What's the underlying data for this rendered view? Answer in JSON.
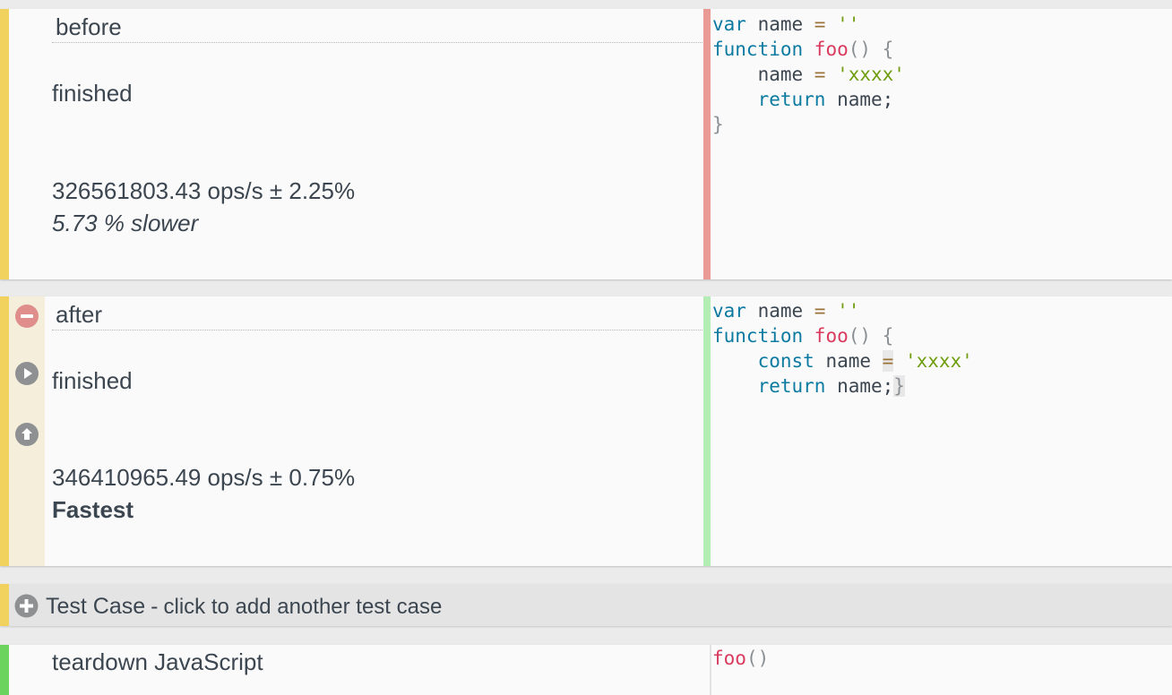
{
  "tests": [
    {
      "title": "before",
      "status": "finished",
      "ops": "326561803.43 ops/s ± 2.25%",
      "comparison": "5.73 % slower",
      "status_color": "#e99a94"
    },
    {
      "title": "after",
      "status": "finished",
      "ops": "346410965.49 ops/s ± 0.75%",
      "comparison": "Fastest",
      "status_color": "#b2edb4",
      "icons": [
        "remove-icon",
        "play-icon",
        "arrow-up-icon"
      ]
    }
  ],
  "code_before": {
    "l1_kw": "var",
    "l1_name": " name ",
    "l1_op": "=",
    "l1_str": " ''",
    "l2_kw": "function",
    "l2_fn": " foo",
    "l2_pn": "() {",
    "l3_name": "    name ",
    "l3_op": "=",
    "l3_str": " 'xxxx'",
    "l4_kw": "    return",
    "l4_rest": " name;",
    "l5_pn": "}"
  },
  "code_after": {
    "l1_kw": "var",
    "l1_name": " name ",
    "l1_op": "=",
    "l1_str": " ''",
    "l2_kw": "function",
    "l2_fn": " foo",
    "l2_pn": "() {",
    "l3_kw": "    const",
    "l3_name": " name ",
    "l3_op": "=",
    "l3_str": " 'xxxx'",
    "l4_kw": "    return",
    "l4_rest": " name;",
    "l4_pn": "}"
  },
  "add_test": {
    "label": "Test Case",
    "separator": "-",
    "hint": "click to add another test case"
  },
  "teardown": {
    "title": "teardown JavaScript",
    "code_fn": "foo",
    "code_pn": "()"
  },
  "colors": {
    "accent_yellow": "#f1d25f",
    "accent_green": "#6cd45e",
    "keyword": "#0c7aa1",
    "function_name": "#d93a5d",
    "string": "#6f9d0f"
  }
}
